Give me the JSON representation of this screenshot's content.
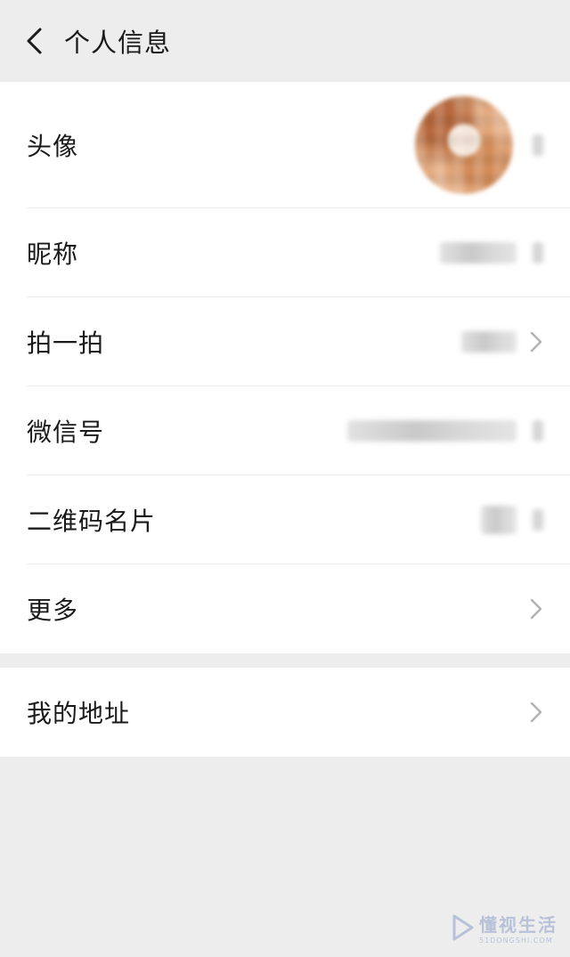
{
  "header": {
    "title": "个人信息"
  },
  "sections": [
    {
      "rows": [
        {
          "label": "头像"
        },
        {
          "label": "昵称"
        },
        {
          "label": "拍一拍"
        },
        {
          "label": "微信号"
        },
        {
          "label": "二维码名片"
        },
        {
          "label": "更多"
        }
      ]
    },
    {
      "rows": [
        {
          "label": "我的地址"
        }
      ]
    }
  ],
  "watermark": {
    "main": "懂视生活",
    "sub": "51DONGSHI.COM"
  },
  "colors": {
    "page_bg": "#ededed",
    "section_bg": "#ffffff",
    "text": "#1a1a1a",
    "chevron": "#b2b2b2",
    "divider": "#ececec"
  }
}
